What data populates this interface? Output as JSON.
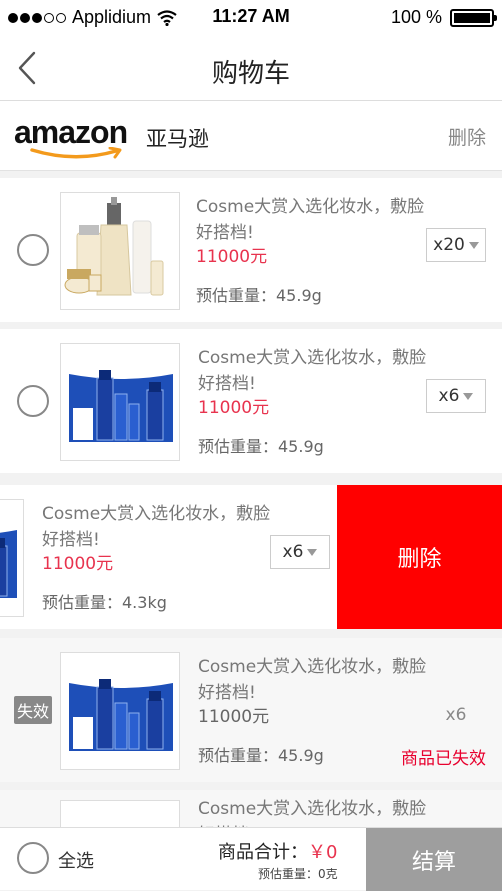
{
  "status_bar": {
    "carrier": "Applidium",
    "time": "11:27 AM",
    "battery": "100 %"
  },
  "nav": {
    "title": "购物车"
  },
  "store": {
    "logo": "amazon",
    "name": "亚马逊",
    "delete_label": "删除"
  },
  "items": [
    {
      "name": "Cosme大赏入选化妆水，敷脸好搭档!",
      "price": "11000元",
      "weight": "预估重量：45.9g",
      "qty": "x20"
    },
    {
      "name": "Cosme大赏入选化妆水，敷脸好搭档!",
      "price": "11000元",
      "weight": "预估重量：45.9g",
      "qty": "x6"
    },
    {
      "name": "Cosme大赏入选化妆水，敷脸好搭档!",
      "price": "11000元",
      "weight": "预估重量：4.3kg",
      "qty": "x6",
      "swipe_delete": "删除"
    },
    {
      "name": "Cosme大赏入选化妆水，敷脸好搭档!",
      "price": "11000元",
      "weight": "预估重量：45.9g",
      "qty": "x6",
      "badge": "失效",
      "status": "商品已失效"
    },
    {
      "name": "Cosme大赏入选化妆水，敷脸好搭档!"
    }
  ],
  "footer": {
    "select_all": "全选",
    "total_label": "商品合计：",
    "total_amount": "￥0",
    "weight": "预估重量：0克",
    "checkout": "结算"
  },
  "colors": {
    "price": "#e8334e",
    "delete_bg": "#ff0000",
    "invalid_text": "#e8002e",
    "checkout_bg": "#9e9e9e"
  }
}
